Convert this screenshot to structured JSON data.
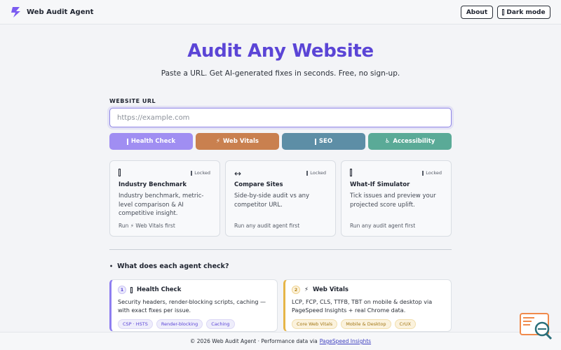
{
  "header": {
    "brand_name": "Web Audit Agent",
    "logo_icon": "lightning-bolt-icon",
    "brand_color": "#7b5cf0",
    "about_label": "About",
    "dark_mode_label": "Dark mode"
  },
  "hero": {
    "title": "Audit Any Website",
    "subtitle": "Paste a URL. Get AI-generated fixes in seconds. Free, no sign-up."
  },
  "url_form": {
    "label": "WEBSITE URL",
    "placeholder": "https://example.com",
    "value": ""
  },
  "agent_buttons": [
    {
      "label": "Health Check",
      "icon": "bar-icon",
      "color": "#a08ef2"
    },
    {
      "label": "Web Vitals",
      "icon": "⚡",
      "color": "#c9804f"
    },
    {
      "label": "SEO",
      "icon": "bar-icon",
      "color": "#5d8ea6"
    },
    {
      "label": "Accessibility",
      "icon": "♿",
      "color": "#5aaa97"
    }
  ],
  "feature_cards": [
    {
      "title": "Industry Benchmark",
      "icon": "bar-icon",
      "locked_label": "Locked",
      "desc": "Industry benchmark, metric-level comparison & AI competitive insight.",
      "footer": "Run ⚡ Web Vitals first"
    },
    {
      "title": "Compare Sites",
      "icon": "↔",
      "locked_label": "Locked",
      "desc": "Side-by-side audit vs any competitor URL.",
      "footer": "Run any audit agent first"
    },
    {
      "title": "What-If Simulator",
      "icon": "bar-icon",
      "locked_label": "Locked",
      "desc": "Tick issues and preview your projected score uplift.",
      "footer": "Run any audit agent first"
    }
  ],
  "faq": {
    "marker": "•",
    "title": "What does each agent check?"
  },
  "agent_details": [
    {
      "num": "1",
      "icon": "bar-icon",
      "title": "Health Check",
      "desc": "Security headers, render-blocking scripts, caching — with exact fixes per issue.",
      "chips": [
        "CSP · HSTS",
        "Render-blocking",
        "Caching"
      ]
    },
    {
      "num": "2",
      "icon": "⚡",
      "title": "Web Vitals",
      "desc": "LCP, FCP, CLS, TTFB, TBT on mobile & desktop via PageSpeed Insights + real Chrome data.",
      "chips": [
        "Core Web Vitals",
        "Mobile & Desktop",
        "CrUX"
      ]
    }
  ],
  "footer": {
    "text": "© 2026 Web Audit Agent · Performance data via",
    "link": "PageSpeed Insights"
  },
  "fab": {
    "icon": "search-chat-icon",
    "color": "#f08a4b"
  }
}
